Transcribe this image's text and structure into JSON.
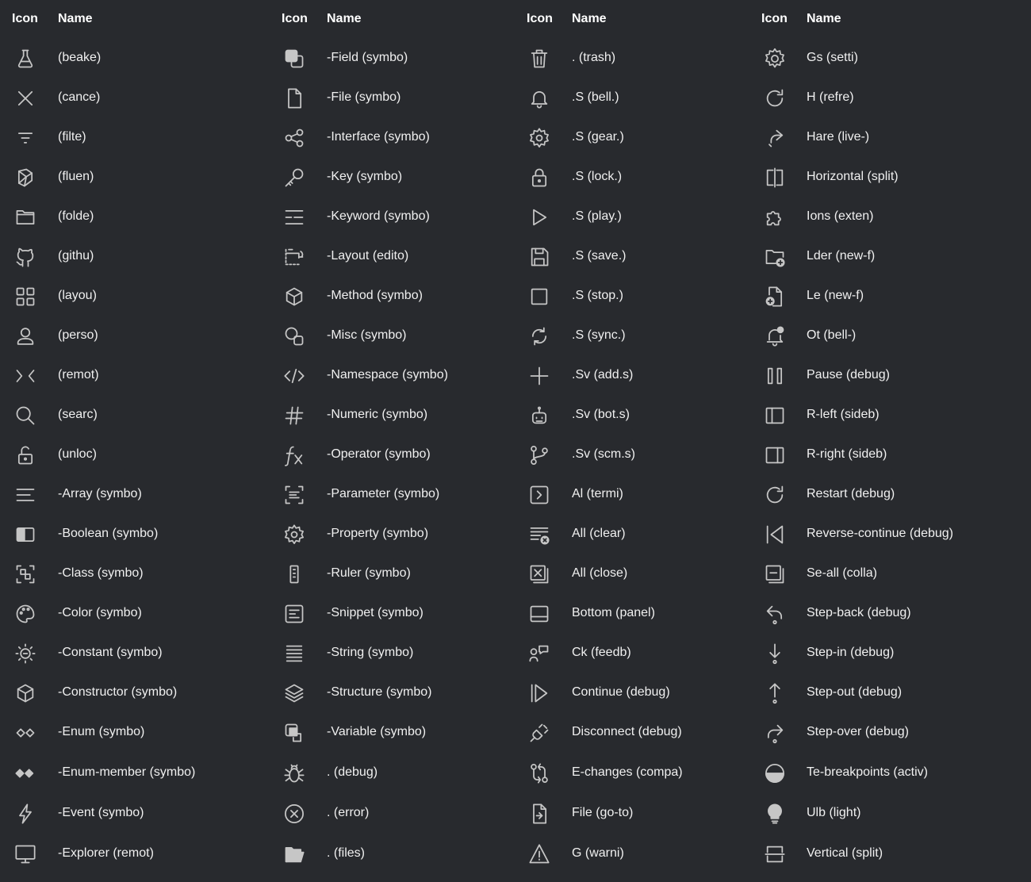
{
  "header": {
    "icon": "Icon",
    "name": "Name"
  },
  "columns": [
    {
      "rows": [
        {
          "icon": "beaker-icon",
          "name": "(beake)"
        },
        {
          "icon": "close-icon",
          "name": "(cance)"
        },
        {
          "icon": "filter-icon",
          "name": "(filte)"
        },
        {
          "icon": "fluent-icon",
          "name": "(fluen)"
        },
        {
          "icon": "folder-icon",
          "name": "(folde)"
        },
        {
          "icon": "github-icon",
          "name": "(githu)"
        },
        {
          "icon": "layout-icon",
          "name": "(layou)"
        },
        {
          "icon": "person-icon",
          "name": "(perso)"
        },
        {
          "icon": "remote-icon",
          "name": "(remot)"
        },
        {
          "icon": "search-icon",
          "name": "(searc)"
        },
        {
          "icon": "unlock-icon",
          "name": "(unloc)"
        },
        {
          "icon": "symbol-array-icon",
          "name": "-Array (symbo)"
        },
        {
          "icon": "symbol-boolean-icon",
          "name": "-Boolean (symbo)"
        },
        {
          "icon": "symbol-class-icon",
          "name": "-Class (symbo)"
        },
        {
          "icon": "symbol-color-icon",
          "name": "-Color (symbo)"
        },
        {
          "icon": "symbol-constant-icon",
          "name": "-Constant (symbo)"
        },
        {
          "icon": "symbol-constructor-icon",
          "name": "-Constructor (symbo)"
        },
        {
          "icon": "symbol-enum-icon",
          "name": "-Enum (symbo)"
        },
        {
          "icon": "symbol-enum-member-icon",
          "name": "-Enum-member (symbo)"
        },
        {
          "icon": "symbol-event-icon",
          "name": "-Event (symbo)"
        },
        {
          "icon": "remote-explorer-icon",
          "name": "-Explorer (remot)"
        }
      ]
    },
    {
      "rows": [
        {
          "icon": "symbol-field-icon",
          "name": "-Field (symbo)"
        },
        {
          "icon": "symbol-file-icon",
          "name": "-File (symbo)"
        },
        {
          "icon": "symbol-interface-icon",
          "name": "-Interface (symbo)"
        },
        {
          "icon": "symbol-key-icon",
          "name": "-Key (symbo)"
        },
        {
          "icon": "symbol-keyword-icon",
          "name": "-Keyword (symbo)"
        },
        {
          "icon": "edit-layout-icon",
          "name": "-Layout (edito)"
        },
        {
          "icon": "symbol-method-icon",
          "name": "-Method (symbo)"
        },
        {
          "icon": "symbol-misc-icon",
          "name": "-Misc (symbo)"
        },
        {
          "icon": "symbol-namespace-icon",
          "name": "-Namespace (symbo)"
        },
        {
          "icon": "symbol-numeric-icon",
          "name": "-Numeric (symbo)"
        },
        {
          "icon": "symbol-operator-icon",
          "name": "-Operator (symbo)"
        },
        {
          "icon": "symbol-parameter-icon",
          "name": "-Parameter (symbo)"
        },
        {
          "icon": "symbol-property-icon",
          "name": "-Property (symbo)"
        },
        {
          "icon": "symbol-ruler-icon",
          "name": "-Ruler (symbo)"
        },
        {
          "icon": "symbol-snippet-icon",
          "name": "-Snippet (symbo)"
        },
        {
          "icon": "symbol-string-icon",
          "name": "-String (symbo)"
        },
        {
          "icon": "symbol-structure-icon",
          "name": "-Structure (symbo)"
        },
        {
          "icon": "symbol-variable-icon",
          "name": "-Variable (symbo)"
        },
        {
          "icon": "debug-icon",
          "name": ". (debug)"
        },
        {
          "icon": "error-icon",
          "name": ". (error)"
        },
        {
          "icon": "files-icon",
          "name": ". (files)"
        }
      ]
    },
    {
      "rows": [
        {
          "icon": "trash-icon",
          "name": ". (trash)"
        },
        {
          "icon": "bell-icon",
          "name": ".S (bell.)"
        },
        {
          "icon": "gear-icon",
          "name": ".S (gear.)"
        },
        {
          "icon": "lock-icon",
          "name": ".S (lock.)"
        },
        {
          "icon": "play-icon",
          "name": ".S (play.)"
        },
        {
          "icon": "save-icon",
          "name": ".S (save.)"
        },
        {
          "icon": "stop-icon",
          "name": ".S (stop.)"
        },
        {
          "icon": "sync-icon",
          "name": ".S (sync.)"
        },
        {
          "icon": "add-icon",
          "name": ".Sv (add.s)"
        },
        {
          "icon": "bot-icon",
          "name": ".Sv (bot.s)"
        },
        {
          "icon": "scm-icon",
          "name": ".Sv (scm.s)"
        },
        {
          "icon": "terminal-icon",
          "name": "Al (termi)"
        },
        {
          "icon": "clear-all-icon",
          "name": "All (clear)"
        },
        {
          "icon": "close-all-icon",
          "name": "All (close)"
        },
        {
          "icon": "panel-bottom-icon",
          "name": "Bottom (panel)"
        },
        {
          "icon": "feedback-icon",
          "name": "Ck (feedb)"
        },
        {
          "icon": "debug-continue-icon",
          "name": "Continue (debug)"
        },
        {
          "icon": "debug-disconnect-icon",
          "name": "Disconnect (debug)"
        },
        {
          "icon": "compare-changes-icon",
          "name": "E-changes (compa)"
        },
        {
          "icon": "go-to-file-icon",
          "name": "File (go-to)"
        },
        {
          "icon": "warning-icon",
          "name": "G (warni)"
        }
      ]
    },
    {
      "rows": [
        {
          "icon": "settings-gear-icon",
          "name": "Gs (setti)"
        },
        {
          "icon": "refresh-icon",
          "name": "H (refre)"
        },
        {
          "icon": "live-share-icon",
          "name": "Hare (live-)"
        },
        {
          "icon": "split-horizontal-icon",
          "name": "Horizontal (split)"
        },
        {
          "icon": "extensions-icon",
          "name": "Ions (exten)"
        },
        {
          "icon": "new-folder-icon",
          "name": "Lder (new-f)"
        },
        {
          "icon": "new-file-icon",
          "name": "Le (new-f)"
        },
        {
          "icon": "bell-dot-icon",
          "name": "Ot (bell-)"
        },
        {
          "icon": "debug-pause-icon",
          "name": "Pause (debug)"
        },
        {
          "icon": "sidebar-left-icon",
          "name": "R-left (sideb)"
        },
        {
          "icon": "sidebar-right-icon",
          "name": "R-right (sideb)"
        },
        {
          "icon": "debug-restart-icon",
          "name": "Restart (debug)"
        },
        {
          "icon": "debug-reverse-continue-icon",
          "name": "Reverse-continue (debug)"
        },
        {
          "icon": "collapse-all-icon",
          "name": "Se-all (colla)"
        },
        {
          "icon": "debug-step-back-icon",
          "name": "Step-back (debug)"
        },
        {
          "icon": "debug-step-into-icon",
          "name": "Step-in (debug)"
        },
        {
          "icon": "debug-step-out-icon",
          "name": "Step-out (debug)"
        },
        {
          "icon": "debug-step-over-icon",
          "name": "Step-over (debug)"
        },
        {
          "icon": "activate-breakpoints-icon",
          "name": "Te-breakpoints (activ)"
        },
        {
          "icon": "lightbulb-icon",
          "name": "Ulb (light)"
        },
        {
          "icon": "split-vertical-icon",
          "name": "Vertical (split)"
        }
      ]
    }
  ]
}
